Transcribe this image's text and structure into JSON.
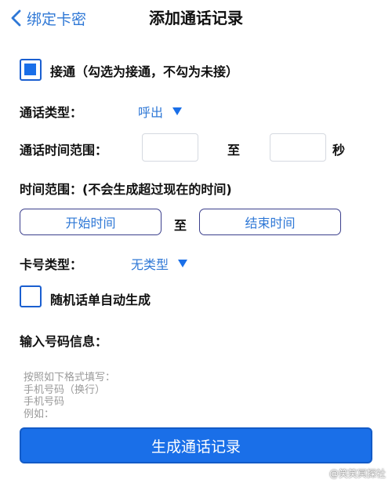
{
  "header": {
    "back_label": "绑定卡密",
    "title": "添加通话记录"
  },
  "connect": {
    "checked": true,
    "label": "接通（勾选为接通，不勾为未接）"
  },
  "call_type": {
    "label": "通话类型：",
    "value": "呼出"
  },
  "duration": {
    "label": "通话时间范围：",
    "min_value": "",
    "separator": "至",
    "max_value": "",
    "unit": "秒"
  },
  "time_range": {
    "label": "时间范围：(不会生成超过现在的时间)",
    "start_label": "开始时间",
    "separator": "至",
    "end_label": "结束时间"
  },
  "card_type": {
    "label": "卡号类型：",
    "value": "无类型"
  },
  "random_auto": {
    "checked": false,
    "label": "随机话单自动生成"
  },
  "number_input": {
    "label": "输入号码信息：",
    "placeholder_lines": [
      "按照如下格式填写：",
      "手机号码（换行）",
      "手机号码",
      "例如："
    ]
  },
  "generate_button": "生成通话记录",
  "watermark": "@笑笑冥探社",
  "colors": {
    "accent": "#1a6fe8",
    "link": "#2f78d6",
    "border_dark": "#3b3f8c"
  }
}
